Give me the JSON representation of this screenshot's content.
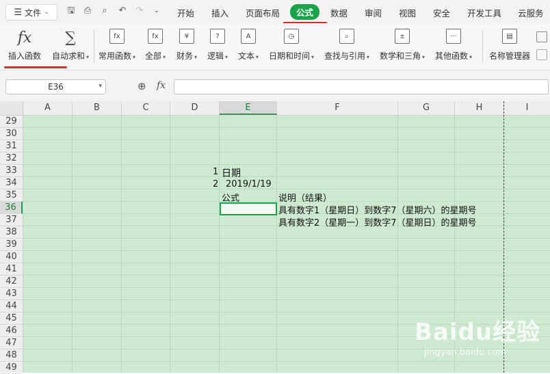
{
  "menubar": {
    "file_label": "文件",
    "tabs": [
      "开始",
      "插入",
      "页面布局",
      "公式",
      "数据",
      "审阅",
      "视图",
      "安全",
      "开发工具",
      "云服务"
    ],
    "active_tab": "公式"
  },
  "ribbon": {
    "buttons": [
      {
        "label": "插入函数",
        "icon": "fx"
      },
      {
        "label": "自动求和",
        "icon": "∑"
      },
      {
        "label": "常用函数",
        "icon": "fx"
      },
      {
        "label": "全部",
        "icon": "fx"
      },
      {
        "label": "财务",
        "icon": "¥"
      },
      {
        "label": "逻辑",
        "icon": "?"
      },
      {
        "label": "文本",
        "icon": "A"
      },
      {
        "label": "日期和时间",
        "icon": "◷"
      },
      {
        "label": "查找与引用",
        "icon": "⌕"
      },
      {
        "label": "数学和三角",
        "icon": "±"
      },
      {
        "label": "其他函数",
        "icon": "···"
      },
      {
        "label": "名称管理器",
        "icon": "▤"
      }
    ]
  },
  "formula_bar": {
    "cell_ref": "E36",
    "fx_label": "fx",
    "formula": ""
  },
  "grid": {
    "columns": [
      "A",
      "B",
      "C",
      "D",
      "E",
      "F",
      "G",
      "H",
      "I"
    ],
    "selected_column": "E",
    "rows": [
      "29",
      "30",
      "31",
      "32",
      "33",
      "34",
      "35",
      "36",
      "37",
      "38",
      "39",
      "40",
      "41",
      "42",
      "43",
      "44",
      "45",
      "46",
      "47",
      "48",
      "49"
    ],
    "selected_row": "36",
    "cells": {
      "r33_num": "1",
      "r33_text": "日期",
      "r34_num": "2",
      "r34_text": "2019/1/19",
      "r35_e": "公式",
      "r35_f": "说明（结果）",
      "r36_f": "具有数字1（星期日）到数字7（星期六）的星期号",
      "r37_f": "具有数字2（星期一）到数字7（星期日）的星期号"
    }
  },
  "watermark": {
    "brand": "Baidu经验",
    "url": "jingyan.baidu.com"
  }
}
